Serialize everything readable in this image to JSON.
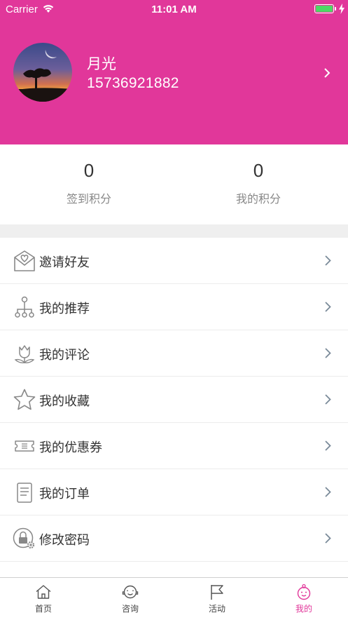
{
  "status_bar": {
    "carrier": "Carrier",
    "time": "11:01 AM"
  },
  "profile": {
    "name": "月光",
    "phone": "15736921882"
  },
  "points": [
    {
      "value": "0",
      "label": "签到积分"
    },
    {
      "value": "0",
      "label": "我的积分"
    }
  ],
  "menu": [
    {
      "label": "邀请好友",
      "icon": "invite-envelope-icon"
    },
    {
      "label": "我的推荐",
      "icon": "recommend-tree-icon"
    },
    {
      "label": "我的评论",
      "icon": "comment-flower-icon"
    },
    {
      "label": "我的收藏",
      "icon": "star-icon"
    },
    {
      "label": "我的优惠券",
      "icon": "coupon-icon"
    },
    {
      "label": "我的订单",
      "icon": "order-document-icon"
    },
    {
      "label": "修改密码",
      "icon": "lock-gear-icon"
    }
  ],
  "tabs": [
    {
      "label": "首页",
      "icon": "home-icon"
    },
    {
      "label": "咨询",
      "icon": "consult-face-icon"
    },
    {
      "label": "活动",
      "icon": "flag-icon"
    },
    {
      "label": "我的",
      "icon": "baby-face-icon"
    }
  ],
  "colors": {
    "accent": "#e1379a",
    "divider": "#efefef",
    "icon_gray": "#888888",
    "battery": "#4cd964"
  }
}
